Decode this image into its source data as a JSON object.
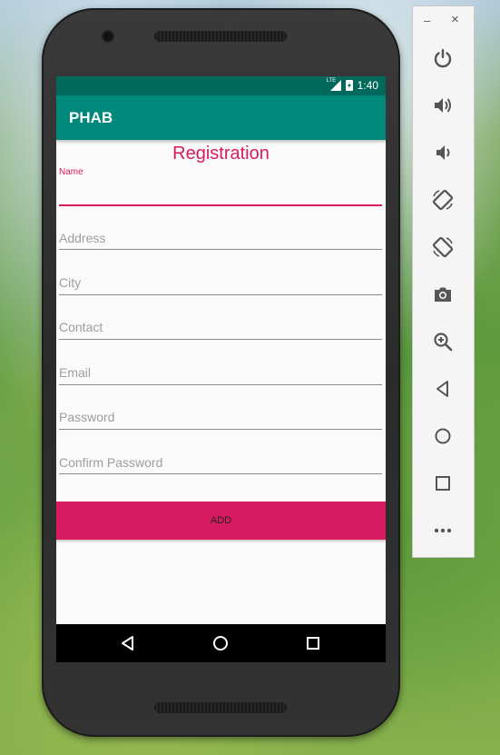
{
  "status_bar": {
    "time": "1:40",
    "network_label": "LTE"
  },
  "app_bar": {
    "title": "PHAB"
  },
  "form": {
    "title": "Registration",
    "fields": [
      {
        "label": "Name",
        "value": ""
      },
      {
        "label": "Address",
        "value": ""
      },
      {
        "label": "City",
        "value": ""
      },
      {
        "label": "Contact",
        "value": ""
      },
      {
        "label": "Email",
        "value": ""
      },
      {
        "label": "Password",
        "value": ""
      },
      {
        "label": "Confirm Password",
        "value": ""
      }
    ],
    "submit_label": "ADD"
  },
  "nav_bar": {
    "buttons": [
      "back-icon",
      "home-icon",
      "recents-icon"
    ]
  },
  "emulator_toolbar": {
    "window_controls": {
      "minimize": "–",
      "close": "×"
    },
    "tools": [
      "power-icon",
      "volume-up-icon",
      "volume-down-icon",
      "rotate-left-icon",
      "rotate-right-icon",
      "camera-icon",
      "zoom-icon",
      "back-icon",
      "home-icon",
      "overview-icon",
      "more-icon"
    ]
  },
  "colors": {
    "primary_dark": "#00695c",
    "primary": "#00897b",
    "accent": "#d81b60"
  }
}
